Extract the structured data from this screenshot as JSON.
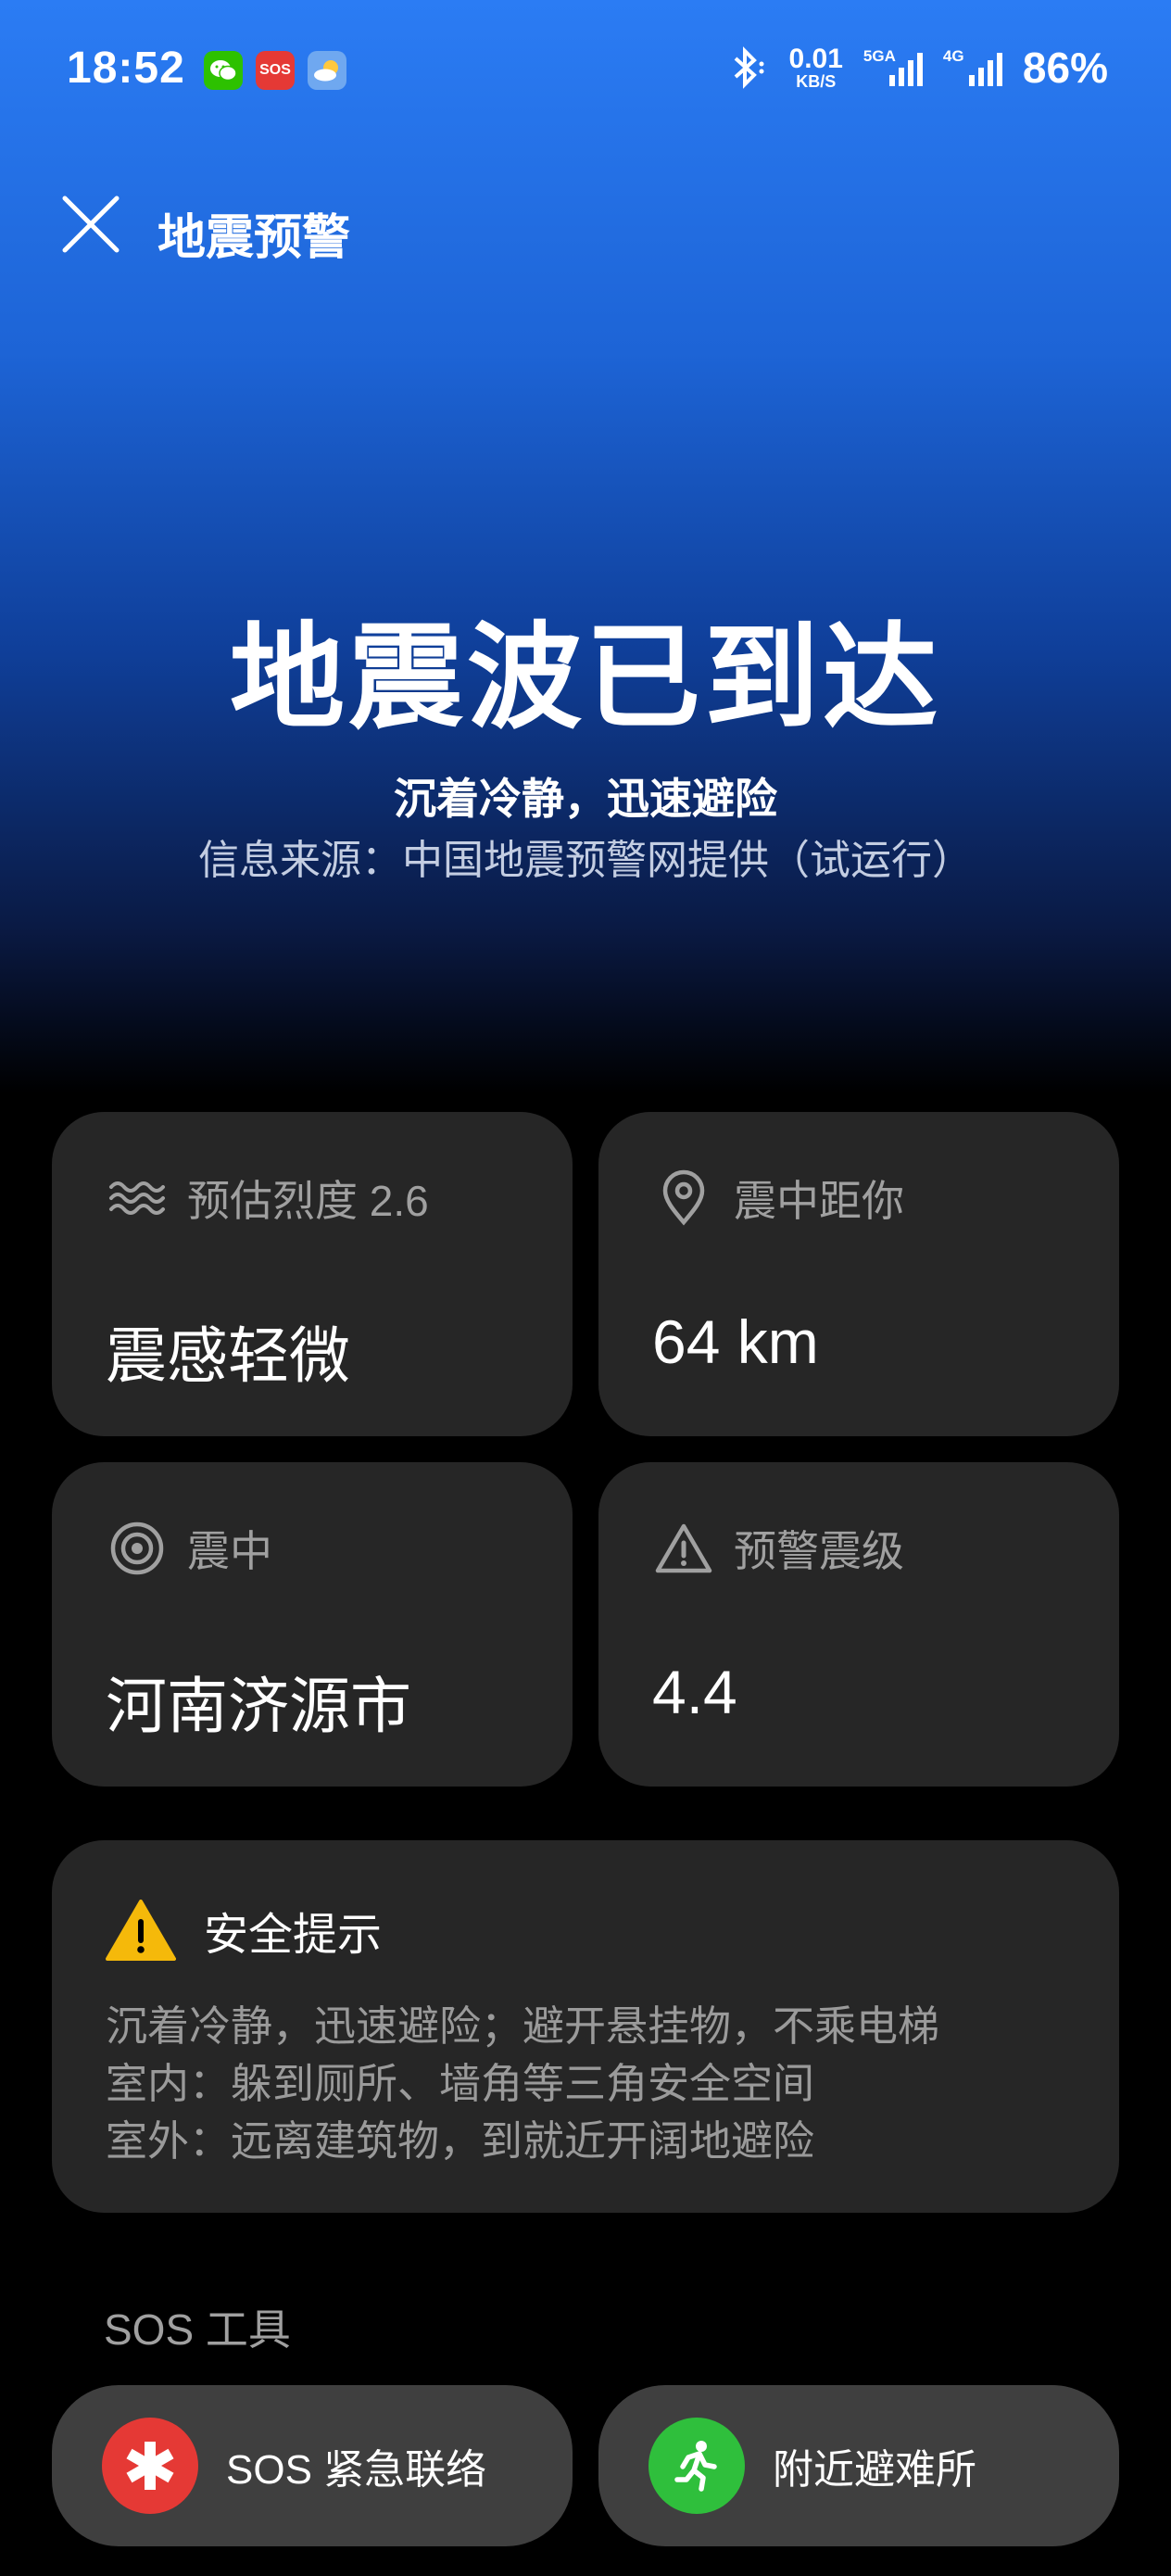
{
  "status_bar": {
    "time": "18:52",
    "sos_badge": "SOS",
    "net_speed_value": "0.01",
    "net_speed_unit": "KB/S",
    "signal1_label": "5GA",
    "signal2_label": "4G",
    "battery": "86%"
  },
  "header": {
    "title": "地震预警"
  },
  "hero": {
    "title": "地震波已到达",
    "subtitle": "沉着冷静，迅速避险",
    "source": "信息来源：中国地震预警网提供（试运行）"
  },
  "cards": {
    "intensity": {
      "label": "预估烈度 2.6",
      "value": "震感轻微"
    },
    "distance": {
      "label": "震中距你",
      "value": "64 km"
    },
    "epicenter": {
      "label": "震中",
      "value": "河南济源市"
    },
    "magnitude": {
      "label": "预警震级",
      "value": "4.4"
    }
  },
  "safety": {
    "title": "安全提示",
    "lines": [
      "沉着冷静，迅速避险；避开悬挂物，不乘电梯",
      "室内：躲到厕所、墙角等三角安全空间",
      "室外：远离建筑物，到就近开阔地避险"
    ]
  },
  "sos": {
    "heading": "SOS 工具",
    "emergency_contact": "SOS 紧急联络",
    "shelter": "附近避难所"
  },
  "colors": {
    "sos_red": "#e53935",
    "shelter_green": "#2fbf3c",
    "warning_yellow": "#f5b90a",
    "card_bg": "#262626"
  }
}
